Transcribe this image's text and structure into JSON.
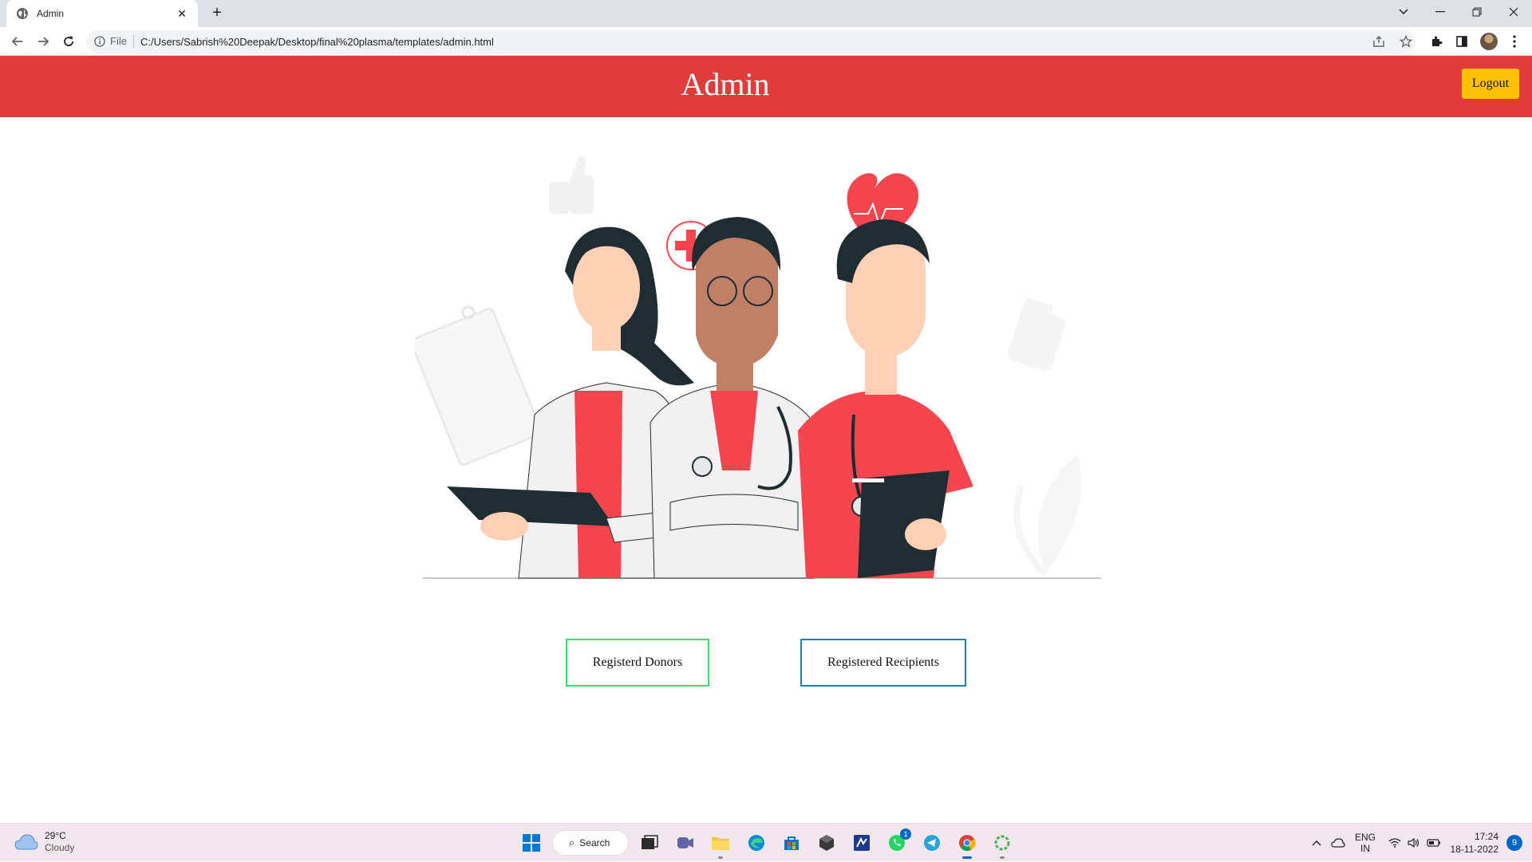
{
  "browser": {
    "tab_title": "Admin",
    "url_scheme": "File",
    "url": "C:/Users/Sabrish%20Deepak/Desktop/final%20plasma/templates/admin.html"
  },
  "header": {
    "title": "Admin",
    "logout_label": "Logout"
  },
  "actions": {
    "donors_label": "Registerd Donors",
    "recipients_label": "Registered Recipients"
  },
  "taskbar": {
    "temperature": "29°C",
    "condition": "Cloudy",
    "search_label": "Search",
    "whatsapp_badge": "1",
    "lang_line1": "ENG",
    "lang_line2": "IN",
    "time": "17:24",
    "date": "18-11-2022",
    "notification_count": "9"
  },
  "colors": {
    "header_bg": "#e03c3c",
    "logout_bg": "#ffc107",
    "donors_border": "#3ddc6a",
    "recipients_border": "#1a7fbf",
    "illustration_red": "#f5464f",
    "illustration_dark": "#1f2d33"
  }
}
